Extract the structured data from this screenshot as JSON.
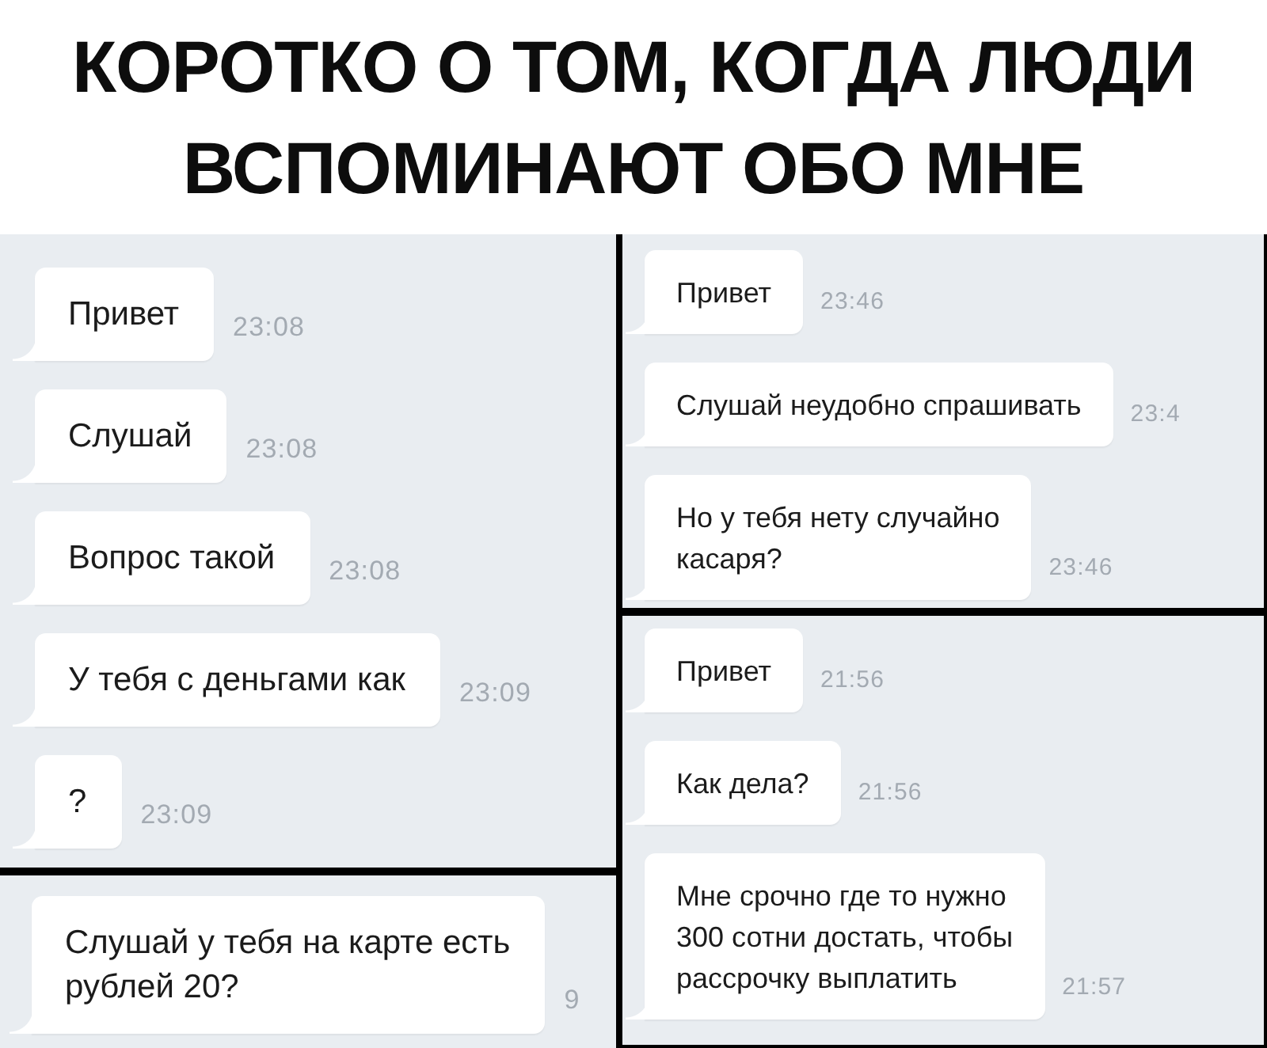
{
  "caption": "КОРОТКО О ТОМ, КОГДА ЛЮДИ ВСПОМИНАЮТ ОБО МНЕ",
  "columns": [
    {
      "panels": [
        {
          "messages": [
            {
              "text": "Привет",
              "time": "23:08"
            },
            {
              "text": "Слушай",
              "time": "23:08"
            },
            {
              "text": "Вопрос такой",
              "time": "23:08"
            },
            {
              "text": "У тебя с деньгами как",
              "time": "23:09"
            },
            {
              "text": "?",
              "time": "23:09"
            }
          ]
        },
        {
          "messages": [
            {
              "text": "Слушай у тебя на карте есть\nрублей 20?",
              "time": "9"
            }
          ]
        }
      ]
    },
    {
      "panels": [
        {
          "messages": [
            {
              "text": "Привет",
              "time": "23:46"
            },
            {
              "text": "Слушай неудобно спрашивать",
              "time": "23:4"
            },
            {
              "text": "Но у тебя нету случайно\nкасаря?",
              "time": "23:46"
            }
          ]
        },
        {
          "messages": [
            {
              "text": "Привет",
              "time": "21:56"
            },
            {
              "text": "Как дела?",
              "time": "21:56"
            },
            {
              "text": "Мне срочно где то нужно\n300 сотни достать, чтобы\nрассрочку выплатить",
              "time": "21:57"
            }
          ]
        }
      ]
    }
  ]
}
